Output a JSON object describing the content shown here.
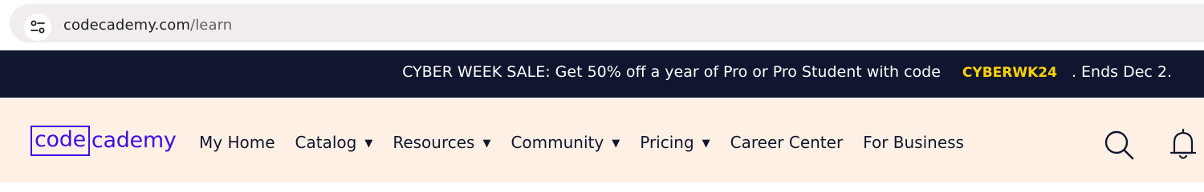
{
  "browser": {
    "url_host": "codecademy.com",
    "url_path": "/learn",
    "site_info_icon": "tune-icon"
  },
  "promo": {
    "text": "CYBER WEEK SALE: Get 50% off a year of Pro or Pro Student with code",
    "code": "CYBERWK24",
    "suffix": ". Ends Dec 2.",
    "code_color": "#ffd300",
    "background": "#10162f"
  },
  "nav": {
    "logo_part1": "code",
    "logo_part2": "cademy",
    "brand_color": "#3a10e5",
    "background": "#fff0e5",
    "items": [
      {
        "label": "My Home",
        "dropdown": false
      },
      {
        "label": "Catalog",
        "dropdown": true
      },
      {
        "label": "Resources",
        "dropdown": true
      },
      {
        "label": "Community",
        "dropdown": true
      },
      {
        "label": "Pricing",
        "dropdown": true
      },
      {
        "label": "Career Center",
        "dropdown": false
      },
      {
        "label": "For Business",
        "dropdown": false
      }
    ],
    "caret": "▼",
    "icons": [
      "search-icon",
      "bell-icon"
    ]
  }
}
